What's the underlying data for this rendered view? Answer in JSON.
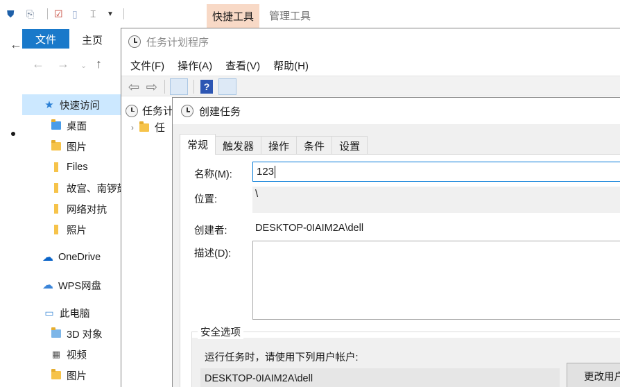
{
  "explorer": {
    "ribbon_context_tab": "快捷工具",
    "ribbon_manage_tab": "管理工具",
    "file_tab": "文件",
    "home_tab": "主页",
    "nav_items": [
      {
        "label": "快速访问",
        "icon": "star-icon"
      },
      {
        "label": "桌面",
        "icon": "folder-icon"
      },
      {
        "label": "图片",
        "icon": "pictures-icon"
      },
      {
        "label": "Files",
        "icon": "folder-icon"
      },
      {
        "label": "故宫、南锣鼓",
        "icon": "folder-icon"
      },
      {
        "label": "网络对抗",
        "icon": "folder-icon"
      },
      {
        "label": "照片",
        "icon": "folder-icon"
      },
      {
        "label": "OneDrive",
        "icon": "cloud-icon"
      },
      {
        "label": "WPS网盘",
        "icon": "cloud-outline-icon"
      },
      {
        "label": "此电脑",
        "icon": "computer-icon"
      },
      {
        "label": "3D 对象",
        "icon": "cube-icon"
      },
      {
        "label": "视频",
        "icon": "video-icon"
      },
      {
        "label": "图片",
        "icon": "pictures-icon"
      }
    ]
  },
  "task_scheduler": {
    "title": "任务计划程序",
    "menu": [
      "文件(F)",
      "操作(A)",
      "查看(V)",
      "帮助(H)"
    ],
    "tree": {
      "root": "任务计",
      "child": "任"
    }
  },
  "dialog": {
    "title": "创建任务",
    "tabs": [
      "常规",
      "触发器",
      "操作",
      "条件",
      "设置"
    ],
    "active_tab": "常规",
    "name_label": "名称(M):",
    "name_value": "123",
    "location_label": "位置:",
    "location_value": "\\",
    "author_label": "创建者:",
    "author_value": "DESKTOP-0IAIM2A\\dell",
    "description_label": "描述(D):",
    "description_value": "",
    "security": {
      "legend": "安全选项",
      "run_as_prompt": "运行任务时，请使用下列用户帐户:",
      "run_as_value": "DESKTOP-0IAIM2A\\dell",
      "change_button": "更改用户"
    }
  }
}
